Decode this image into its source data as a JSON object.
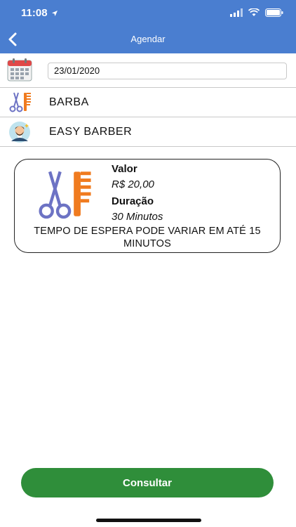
{
  "status_bar": {
    "time": "11:08"
  },
  "nav": {
    "title": "Agendar"
  },
  "date": {
    "value": "23/01/2020"
  },
  "service": {
    "label": "BARBA"
  },
  "barber": {
    "label": "EASY BARBER"
  },
  "details": {
    "price_label": "Valor",
    "price_value": "R$ 20,00",
    "duration_label": "Duração",
    "duration_value": "30 Minutos",
    "note": "TEMPO DE ESPERA PODE VARIAR EM ATÉ 15 MINUTOS"
  },
  "actions": {
    "consult_label": "Consultar"
  },
  "colors": {
    "header": "#4a7ed0",
    "button": "#2f8e3a"
  }
}
